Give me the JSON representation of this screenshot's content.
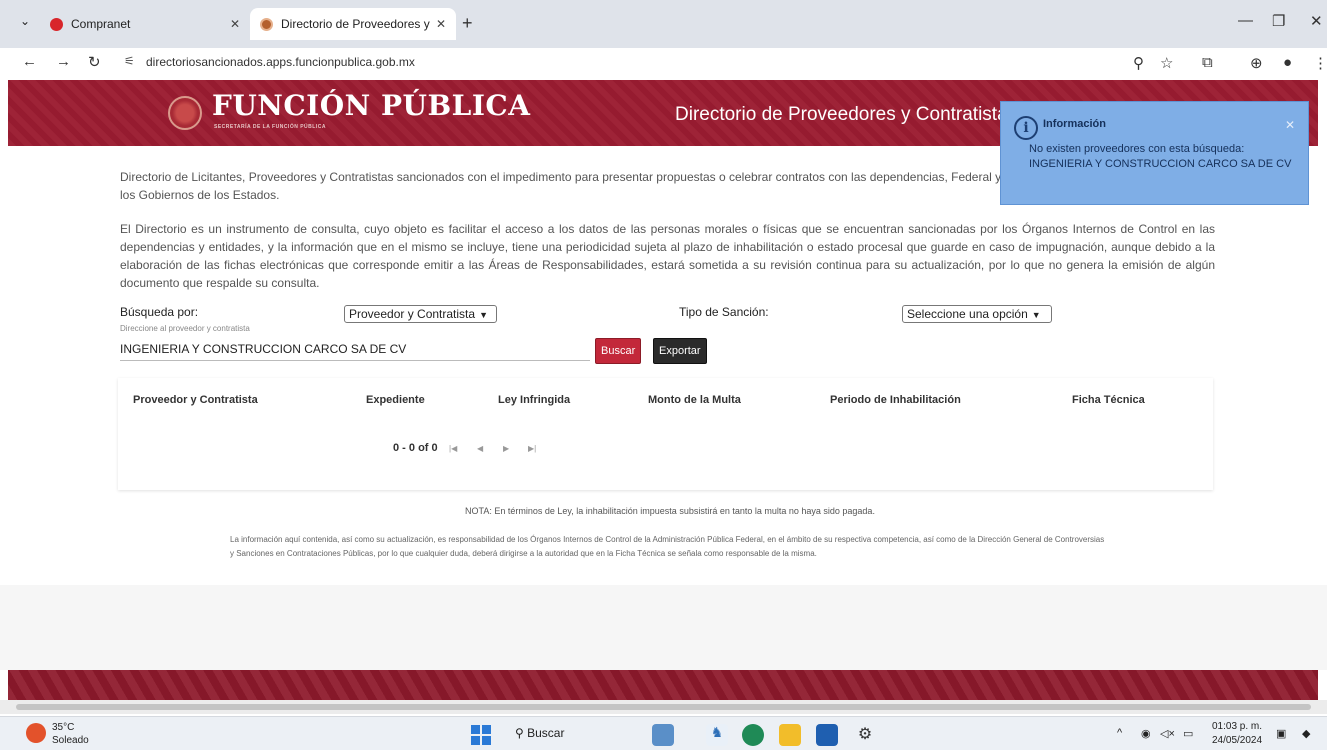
{
  "browser": {
    "tabs": [
      {
        "title": "Compranet",
        "active": false
      },
      {
        "title": "Directorio de Proveedores y C·",
        "active": true
      }
    ],
    "url": "directoriosancionados.apps.funcionpublica.gob.mx"
  },
  "header": {
    "logo_title": "FUNCIÓN PÚBLICA",
    "logo_subtitle": "SECRETARÍA DE LA FUNCIÓN PÚBLICA",
    "page_title": "Directorio de Proveedores y Contratistas"
  },
  "intro": {
    "p1": "Directorio de Licitantes, Proveedores y Contratistas sancionados con el impedimento para presentar propuestas o celebrar contratos con las dependencias, Federal y de los Gobiernos de los Estados.",
    "p2": "El Directorio es un instrumento de consulta, cuyo objeto es facilitar el acceso a los datos de las personas morales o físicas que se encuentran sancionadas por los Órganos Internos de Control en las dependencias y entidades, y la información que en el mismo se incluye, tiene una periodicidad sujeta al plazo de inhabilitación o estado procesal que guarde en caso de impugnación, aunque debido a la elaboración de las fichas electrónicas que corresponde emitir a las Áreas de Responsabilidades, estará sometida a su revisión continua para su actualización, por lo que no genera la emisión de algún documento que respalde su consulta."
  },
  "search": {
    "by_label": "Búsqueda por:",
    "by_value": "Proveedor y Contratista",
    "type_label": "Tipo de Sanción:",
    "type_value": "Seleccione una opción",
    "hint": "Direccione al proveedor y contratista",
    "query": "INGENIERIA Y CONSTRUCCION CARCO SA DE CV",
    "search_button": "Buscar",
    "export_button": "Exportar"
  },
  "table": {
    "columns": [
      "Proveedor y Contratista",
      "Expediente",
      "Ley Infringida",
      "Monto de la Multa",
      "Periodo de Inhabilitación",
      "Ficha Técnica"
    ],
    "pagination": "0 - 0 of 0"
  },
  "footer": {
    "note": "NOTA: En términos de Ley, la inhabilitación impuesta subsistirá en tanto la multa no haya sido pagada.",
    "text": "La información aquí contenida, así como su actualización, es responsabilidad de los Órganos Internos de Control de la Administración Pública Federal, en el ámbito de su respectiva competencia, así como de la Dirección General de Controversias y Sanciones en Contrataciones Públicas, por lo que cualquier duda, deberá dirigirse a la autoridad que en la Ficha Técnica se señala como responsable de la misma."
  },
  "toast": {
    "title": "Información",
    "message": "No existen proveedores con esta búsqueda: INGENIERIA Y CONSTRUCCION CARCO SA DE CV"
  },
  "taskbar": {
    "temperature": "35°C",
    "condition": "Soleado",
    "search_label": "Buscar",
    "time": "01:03 p. m.",
    "date": "24/05/2024"
  },
  "colors": {
    "brand": "#9b1c31",
    "toast": "#7faee6",
    "search_button": "#c3283a"
  }
}
